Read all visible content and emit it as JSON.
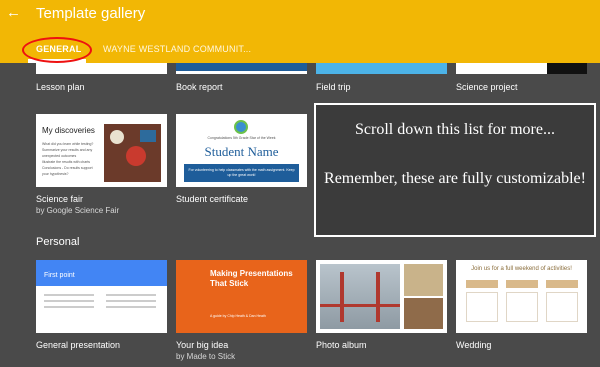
{
  "header": {
    "title": "Template gallery",
    "tabs": [
      {
        "label": "GENERAL"
      },
      {
        "label": "WAYNE WESTLAND COMMUNIT..."
      }
    ]
  },
  "row1": [
    {
      "label": "Lesson plan"
    },
    {
      "label": "Book report"
    },
    {
      "label": "Field trip"
    },
    {
      "label": "Science project"
    }
  ],
  "row2": [
    {
      "label": "Science fair",
      "sublabel": "by Google Science Fair",
      "thumb_heading": "My discoveries",
      "thumb_lines": [
        "What did you learn while testing?",
        "Summarize your results and any unexpected outcomes",
        "Illustrate the results with charts",
        "Conclusions - Do results support your hypothesis?"
      ]
    },
    {
      "label": "Student certificate",
      "thumb_caption": "Congratulations 5th Grade Star of the Week",
      "thumb_name": "Student Name",
      "thumb_body": "For volunteering to help classmates with the math assignment. Keep up the great work!"
    }
  ],
  "overlay": {
    "line1": "Scroll down this list for more...",
    "line2": "Remember, these are fully customizable!"
  },
  "section_personal": "Personal",
  "row3": [
    {
      "label": "General presentation",
      "thumb_title": "First point"
    },
    {
      "label": "Your big idea",
      "sublabel": "by Made to Stick",
      "thumb_title": "Making Presentations That Stick",
      "thumb_sub": "A guide by Chip Heath & Dan Heath"
    },
    {
      "label": "Photo album"
    },
    {
      "label": "Wedding",
      "thumb_title": "Join us for a full weekend of activities!"
    }
  ],
  "colors": {
    "header": "#f2b705",
    "background": "#4a4a4a",
    "highlight_circle": "#e11111",
    "presentation_blue": "#4285f4",
    "bigidea_orange": "#e8641b"
  }
}
